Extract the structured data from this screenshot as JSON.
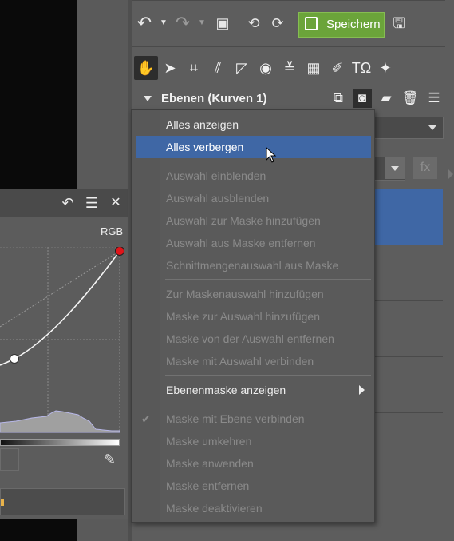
{
  "toolbar": {
    "save_label": "Speichern"
  },
  "layers": {
    "title": "Ebenen (Kurven 1)",
    "fx_label": "fx"
  },
  "curves": {
    "channel_label": "RGB"
  },
  "context_menu": {
    "items": [
      {
        "label": "Alles anzeigen",
        "enabled": true
      },
      {
        "label": "Alles verbergen",
        "enabled": true,
        "highlighted": true
      },
      {
        "label": "Auswahl einblenden",
        "enabled": false
      },
      {
        "label": "Auswahl ausblenden",
        "enabled": false
      },
      {
        "label": "Auswahl zur Maske hinzufügen",
        "enabled": false
      },
      {
        "label": "Auswahl aus Maske entfernen",
        "enabled": false
      },
      {
        "label": "Schnittmengenauswahl aus Maske",
        "enabled": false
      },
      {
        "label": "Zur Maskenauswahl hinzufügen",
        "enabled": false
      },
      {
        "label": "Maske zur Auswahl hinzufügen",
        "enabled": false
      },
      {
        "label": "Maske von der Auswahl entfernen",
        "enabled": false
      },
      {
        "label": "Maske mit Auswahl verbinden",
        "enabled": false
      },
      {
        "label": "Ebenenmaske anzeigen",
        "enabled": true,
        "submenu": true
      },
      {
        "label": "Maske mit Ebene verbinden",
        "enabled": false,
        "checked": true
      },
      {
        "label": "Maske umkehren",
        "enabled": false
      },
      {
        "label": "Maske anwenden",
        "enabled": false
      },
      {
        "label": "Maske entfernen",
        "enabled": false
      },
      {
        "label": "Maske deaktivieren",
        "enabled": false
      }
    ]
  },
  "colors": {
    "accent_highlight": "#3f67a5",
    "save_button": "#6ba43a",
    "curve_endpoint": "#e0151a"
  }
}
